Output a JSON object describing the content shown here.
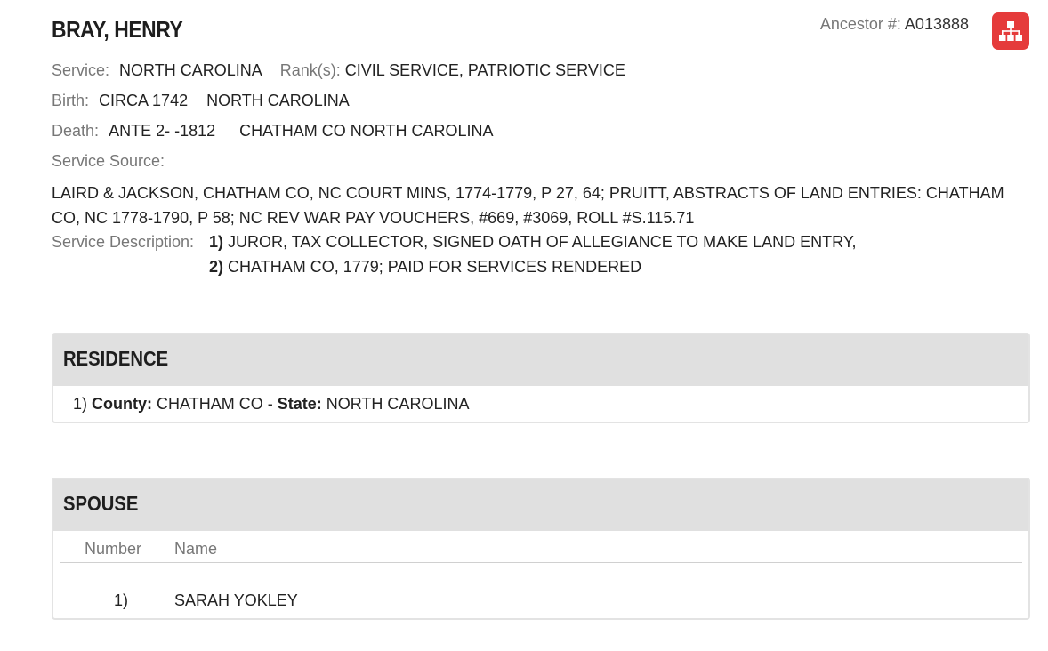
{
  "person": {
    "name": "BRAY, HENRY",
    "ancestor_label": "Ancestor #:",
    "ancestor_number": "A013888"
  },
  "details": {
    "service_label": "Service:",
    "service_value": "NORTH CAROLINA",
    "rank_label": "Rank(s):",
    "rank_value": "CIVIL SERVICE, PATRIOTIC SERVICE",
    "birth_label": "Birth:",
    "birth_date": "CIRCA 1742",
    "birth_place": "NORTH CAROLINA",
    "death_label": "Death:",
    "death_date": "ANTE 2- -1812",
    "death_place": "CHATHAM CO NORTH CAROLINA",
    "service_source_label": "Service Source:",
    "service_source_text": "LAIRD & JACKSON, CHATHAM CO, NC COURT MINS, 1774-1779, P 27, 64; PRUITT, ABSTRACTS OF LAND ENTRIES: CHATHAM CO, NC 1778-1790, P 58; NC REV WAR PAY VOUCHERS, #669, #3069, ROLL #S.115.71",
    "service_description_label": "Service Description:",
    "service_description": [
      {
        "num": "1)",
        "text": "JUROR, TAX COLLECTOR, SIGNED OATH OF ALLEGIANCE TO MAKE LAND ENTRY,"
      },
      {
        "num": "2)",
        "text": "CHATHAM CO, 1779; PAID FOR SERVICES RENDERED"
      }
    ]
  },
  "residence": {
    "title": "RESIDENCE",
    "num": "1)",
    "county_label": "County:",
    "county_value": "CHATHAM CO",
    "dash": "-",
    "state_label": "State:",
    "state_value": "NORTH CAROLINA"
  },
  "spouse": {
    "title": "SPOUSE",
    "col_number": "Number",
    "col_name": "Name",
    "rows": [
      {
        "number": "1)",
        "name": "SARAH YOKLEY"
      }
    ]
  },
  "icons": {
    "tree": "family-tree-icon",
    "tree_color": "#e53b3b"
  }
}
